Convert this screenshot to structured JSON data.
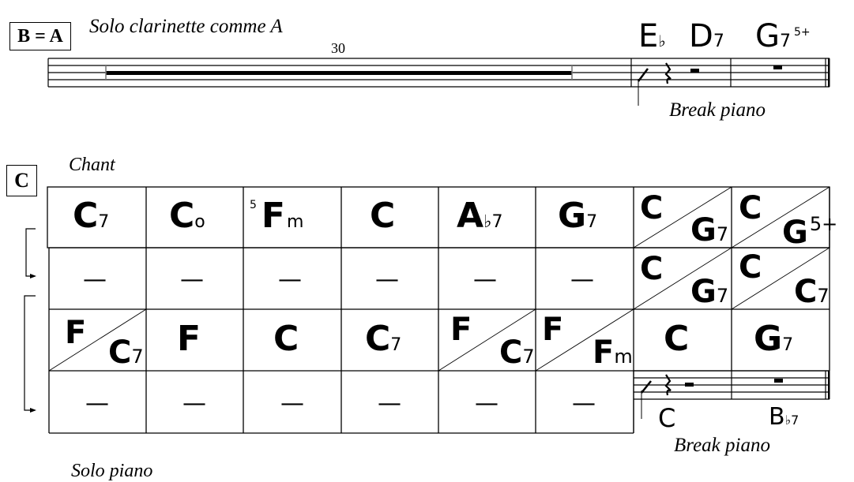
{
  "section_b": {
    "rehearsal_label": "B = A",
    "direction": "Solo clarinette comme A",
    "multirest_count": "30",
    "chords": [
      {
        "root": "E",
        "suffix": "♭"
      },
      {
        "root": "D",
        "suffix": "7"
      },
      {
        "root": "G",
        "suffix": "7",
        "extension": "5+"
      }
    ],
    "break_label": "Break piano"
  },
  "section_c": {
    "rehearsal_label": "C",
    "direction": "Chant",
    "grid": [
      [
        {
          "type": "single",
          "root": "C",
          "suffix": "7"
        },
        {
          "type": "single",
          "root": "C",
          "suffix": "o"
        },
        {
          "type": "single",
          "prefix": "5",
          "root": "F",
          "suffix": "m"
        },
        {
          "type": "single",
          "root": "C",
          "suffix": ""
        },
        {
          "type": "single",
          "root": "A",
          "suffix": "♭7"
        },
        {
          "type": "single",
          "root": "G",
          "suffix": "7"
        },
        {
          "type": "split",
          "top": {
            "root": "C",
            "suffix": ""
          },
          "bottom": {
            "root": "G",
            "suffix": "7"
          }
        },
        {
          "type": "split",
          "top": {
            "root": "C",
            "suffix": ""
          },
          "bottom": {
            "root": "G",
            "suffix": "5+"
          }
        }
      ],
      [
        {
          "type": "repeat",
          "symbol": "—"
        },
        {
          "type": "repeat",
          "symbol": "—"
        },
        {
          "type": "repeat",
          "symbol": "—"
        },
        {
          "type": "repeat",
          "symbol": "—"
        },
        {
          "type": "repeat",
          "symbol": "—"
        },
        {
          "type": "repeat",
          "symbol": "—"
        },
        {
          "type": "split",
          "top": {
            "root": "C",
            "suffix": ""
          },
          "bottom": {
            "root": "G",
            "suffix": "7"
          }
        },
        {
          "type": "split",
          "top": {
            "root": "C",
            "suffix": ""
          },
          "bottom": {
            "root": "C",
            "suffix": "7"
          }
        }
      ],
      [
        {
          "type": "split",
          "top": {
            "root": "F",
            "suffix": ""
          },
          "bottom": {
            "root": "C",
            "suffix": "7"
          }
        },
        {
          "type": "single",
          "root": "F",
          "suffix": ""
        },
        {
          "type": "single",
          "root": "C",
          "suffix": ""
        },
        {
          "type": "single",
          "root": "C",
          "suffix": "7"
        },
        {
          "type": "split",
          "top": {
            "root": "F",
            "suffix": ""
          },
          "bottom": {
            "root": "C",
            "suffix": "7"
          }
        },
        {
          "type": "split",
          "top": {
            "root": "F",
            "suffix": ""
          },
          "bottom": {
            "root": "F",
            "suffix": "m"
          }
        },
        {
          "type": "single",
          "root": "C",
          "suffix": ""
        },
        {
          "type": "single",
          "root": "G",
          "suffix": "7"
        }
      ],
      [
        {
          "type": "repeat",
          "symbol": "—"
        },
        {
          "type": "repeat",
          "symbol": "—"
        },
        {
          "type": "repeat",
          "symbol": "—"
        },
        {
          "type": "repeat",
          "symbol": "—"
        },
        {
          "type": "repeat",
          "symbol": "—"
        },
        {
          "type": "repeat",
          "symbol": "—"
        }
      ]
    ],
    "break_chords": [
      {
        "root": "C",
        "suffix": ""
      },
      {
        "root": "B",
        "suffix": "♭7"
      }
    ],
    "break_label": "Break piano"
  },
  "section_d": {
    "direction": "Solo piano"
  }
}
